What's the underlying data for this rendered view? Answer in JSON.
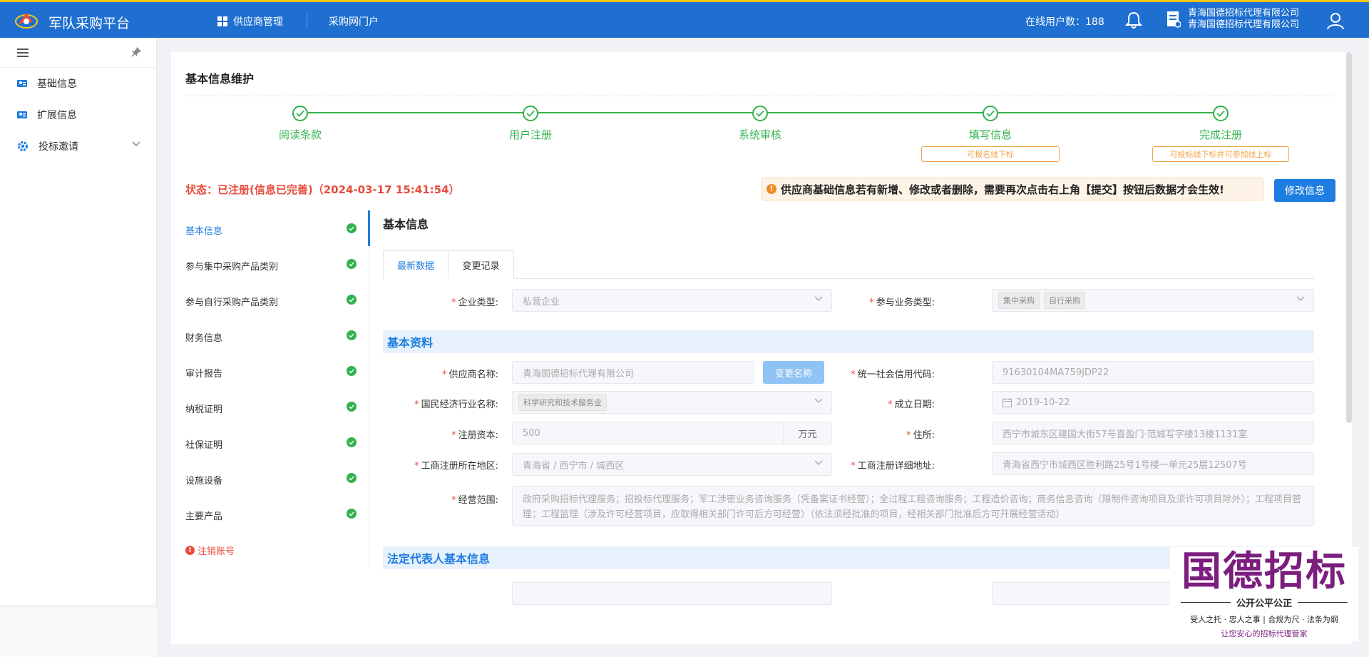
{
  "header": {
    "brand": "军队采购平台",
    "nav": [
      "供应商管理",
      "采购网门户"
    ],
    "online_label": "在线用户数：188",
    "company_line1": "青海国德招标代理有限公司",
    "company_line2": "青海国德招标代理有限公司",
    "accent": "#1e6fd0",
    "top_stripe": "#f5c518"
  },
  "sidebar": {
    "items": [
      {
        "label": "基础信息",
        "icon": "id-card-icon"
      },
      {
        "label": "扩展信息",
        "icon": "id-card-icon"
      },
      {
        "label": "投标邀请",
        "icon": "gear-icon"
      }
    ]
  },
  "page": {
    "title": "基本信息维护",
    "steps": [
      {
        "label": "阅读条款",
        "tag": ""
      },
      {
        "label": "用户注册",
        "tag": ""
      },
      {
        "label": "系统审核",
        "tag": ""
      },
      {
        "label": "填写信息",
        "tag": "可报名线下标"
      },
      {
        "label": "完成注册",
        "tag": "可投标线下标并可参加线上标"
      }
    ],
    "status": "状态：已注册(信息已完善)（2024-03-17 15:41:54）",
    "notice": "供应商基础信息若有新增、修改或者删除，需要再次点击右上角【提交】按钮后数据才会生效!",
    "edit_button": "修改信息"
  },
  "section_nav": {
    "items": [
      "基本信息",
      "参与集中采购产品类别",
      "参与自行采购产品类别",
      "财务信息",
      "审计报告",
      "纳税证明",
      "社保证明",
      "设施设备",
      "主要产品"
    ],
    "cancel_label": "注销账号"
  },
  "form": {
    "title": "基本信息",
    "tabs": [
      "最新数据",
      "变更记录"
    ],
    "enterprise_type_label": "企业类型:",
    "enterprise_type_value": "私营企业",
    "business_type_label": "参与业务类型:",
    "business_type_chips": [
      "集中采购",
      "自行采购"
    ],
    "section_basic": "基本资料",
    "supplier_name_label": "供应商名称:",
    "supplier_name_value": "青海国德招标代理有限公司",
    "rename_button": "变更名称",
    "credit_code_label": "统一社会信用代码:",
    "credit_code_value": "91630104MA759JDP22",
    "industry_label": "国民经济行业名称:",
    "industry_value": "科学研究和技术服务业",
    "found_date_label": "成立日期:",
    "found_date_value": "2019-10-22",
    "capital_label": "注册资本:",
    "capital_value": "500",
    "capital_unit": "万元",
    "address_label": "住所:",
    "address_value": "西宁市城东区建国大街57号喜盈门·范城写字楼13楼1131室",
    "region_label": "工商注册所在地区:",
    "region_value": "青海省 / 西宁市 / 城西区",
    "reg_address_label": "工商注册详细地址:",
    "reg_address_value": "青海省西宁市城西区胜利路25号1号楼一单元25层12507号",
    "scope_label": "经营范围:",
    "scope_value": "政府采购招标代理服务；招投标代理服务；军工涉密业务咨询服务（凭备案证书经营）；全过程工程咨询服务；工程造价咨询；商务信息咨询（限制件咨询项目及须许可项目除外）；工程项目管理；工程监理（涉及许可经营项目，应取得相关部门许可后方可经营）（依法须经批准的项目，经相关部门批准后方可开展经营活动）",
    "section_legal": "法定代表人基本信息"
  },
  "watermark": {
    "name": "国德招标",
    "slogan": "公开公平公正",
    "motto": "受人之托 · 忠人之事 | 合规为尺 · 法条为纲",
    "tagline": "让您安心的招标代理管家"
  }
}
